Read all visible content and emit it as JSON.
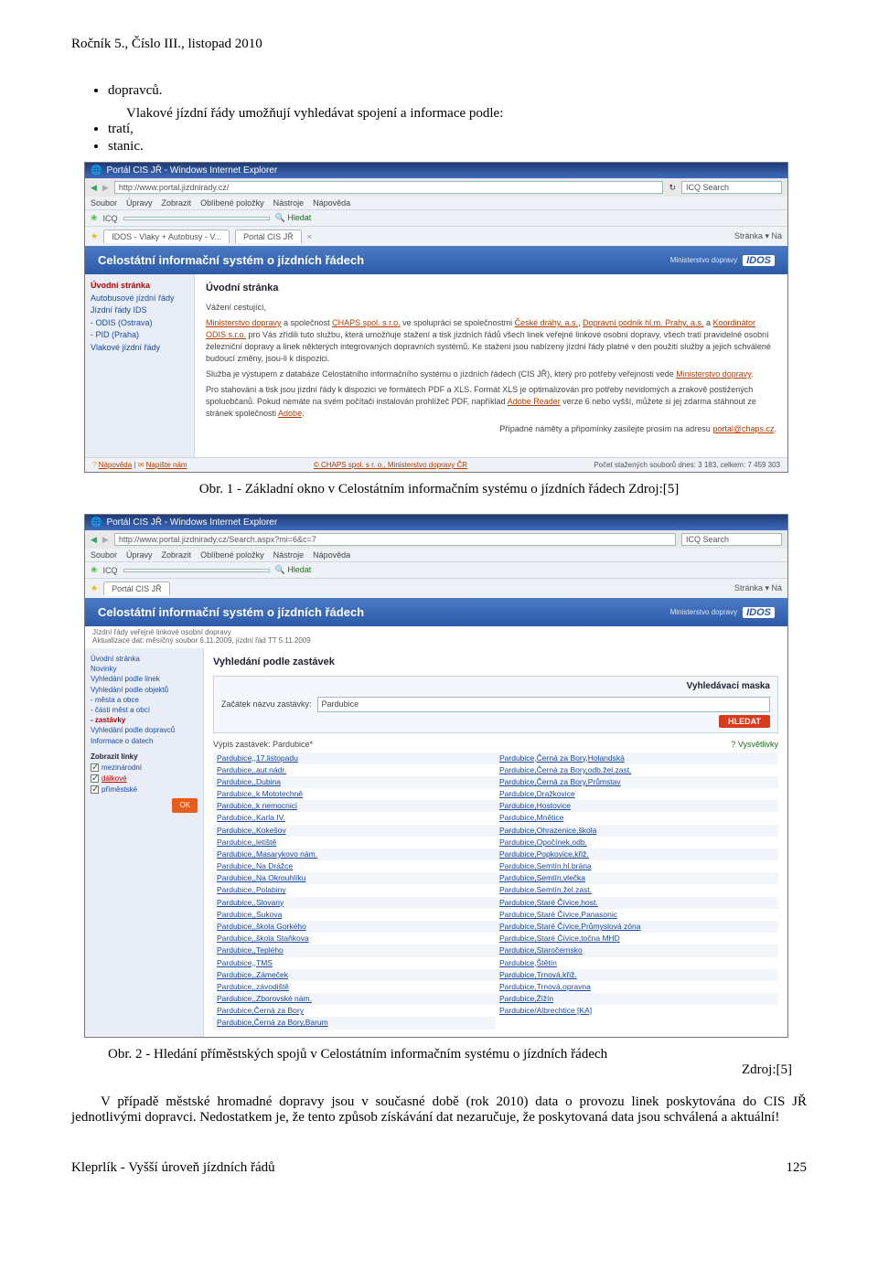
{
  "header": "Ročník 5., Číslo III., listopad 2010",
  "bullets": {
    "b1": "dopravců."
  },
  "lead": "Vlakové jízdní řády umožňují vyhledávat spojení a informace podle:",
  "bullets2": {
    "b1": "tratí,",
    "b2": "stanic."
  },
  "caption1": "Obr. 1 - Základní okno v Celostátním informačním systému o jízdních řádech    Zdroj:[5]",
  "caption2": "Obr. 2 - Hledání příměstských spojů v Celostátním informačním systému o jízdních řádech",
  "caption2b": "Zdroj:[5]",
  "para": "V případě městské hromadné dopravy jsou v současné době (rok 2010) data o provozu linek poskytována do CIS JŘ jednotlivými dopravci. Nedostatkem je, že tento způsob získávání dat nezaručuje, že poskytovaná data jsou schválená a aktuální!",
  "footer_left": "Kleprlík - Vyšší úroveň jízdních řádů",
  "footer_right": "125",
  "shot1": {
    "title": "Portál CIS JŘ - Windows Internet Explorer",
    "url": "http://www.portal.jizdnirady.cz/",
    "search": "ICQ Search",
    "menu": [
      "Soubor",
      "Úpravy",
      "Zobrazit",
      "Oblíbené položky",
      "Nástroje",
      "Nápověda"
    ],
    "icq": "ICQ",
    "hledat": "Hledat",
    "tab1": "IDOS - Vlaky + Autobusy - V...",
    "tab2": "Portál CIS JŘ",
    "toolbar_right": "Stránka ▾  Ná",
    "banner": "Celostátní informační systém o jízdních řádech",
    "mini": "Ministerstvo dopravy",
    "logo": "IDOS",
    "side": {
      "s1": "Úvodní stránka",
      "s2": "Autobusové jízdní řády",
      "s3": "Jízdní řády IDS",
      "s4": "- ODIS (Ostrava)",
      "s5": "- PID (Praha)",
      "s6": "Vlakové jízdní řády"
    },
    "main_h": "Úvodní stránka",
    "greet": "Vážení cestující,",
    "links": {
      "a": "Ministerstvo dopravy",
      "b": "CHAPS spol. s.r.o.",
      "c": "České dráhy, a.s.",
      "d": "Dopravní podnik hl.m. Prahy, a.s.",
      "e": "Koordinátor ODIS s.r.o."
    },
    "p1a": " a společnost ",
    "p1b": " ve spolupráci se společnostmi ",
    "p1c": ", ",
    "p1d": " a ",
    "p1e": " pro Vás zřídili tuto službu, která umožňuje stažení a tisk jízdních řádů všech linek veřejné linkové osobní dopravy, všech tratí pravidelné osobní železniční dopravy a linek některých integrovaných dopravních systémů. Ke stažení jsou nabízeny jízdní řády platné v den použití služby a jejich schválené budoucí změny, jsou-li k dispozici.",
    "p2a": "Služba je výstupem z databáze Celostátního informačního systému o jízdních řádech (CIS JŘ), který pro potřeby veřejnosti vede ",
    "p2l": "Ministerstvo dopravy",
    "p3a": "Pro stahování a tisk jsou jízdní řády k dispozici ve formátech PDF a XLS. Formát XLS je optimalizován pro potřeby nevidomých a zrakově postižených spoluobčanů. Pokud nemáte na svém počítači instalován prohlížeč PDF, například ",
    "p3l": "Adobe Reader",
    "p3b": " verze 6 nebo vyšší, můžete si jej zdarma stáhnout ze stránek společnosti ",
    "p3c": "Adobe",
    "p4a": "Případné náměty a připomínky zasílejte prosím na adresu ",
    "mail": "portal@chaps.cz",
    "foot_l1": "Nápověda",
    "foot_l2": "Napište nám",
    "foot_c": "© CHAPS spol. s r. o.,  Ministerstvo dopravy ČR",
    "foot_r": "Počet stažených souborů dnes: 3 183, celkem: 7 459 303"
  },
  "shot2": {
    "title": "Portál CIS JŘ - Windows Internet Explorer",
    "url": "http://www.portal.jizdnirady.cz/Search.aspx?mi=6&c=7",
    "tab": "Portál CIS JŘ",
    "banner": "Celostátní informační systém o jízdních řádech",
    "sub1": "Jízdní řády veřejné linkové osobní dopravy",
    "sub2": "Aktualizace dat: měsíčný soubor 6.11.2009, jízdní řád TT 5.11.2009",
    "side": {
      "s1": "Úvodní stránka",
      "s2": "Novinky",
      "s3": "Vyhledání podle linek",
      "s4": "Vyhledání podle objektů",
      "s5": "- města a obce",
      "s6": "- části měst a obcí",
      "s7": "- zastávky",
      "s8": "Vyhledání podle dopravců",
      "s9": "Informace o datech",
      "zl": "Zobrazit linky",
      "c1": "mezinárodní",
      "c2": "dálkové",
      "c3": "příměstské",
      "ok": "OK"
    },
    "main_h": "Vyhledání podle zastávek",
    "mask_title": "Vyhledávací maska",
    "mask_label": "Začátek názvu zastávky:",
    "mask_value": "Pardubice",
    "hledat": "HLEDAT",
    "res_l": "Výpis zastávek: Pardubice*",
    "res_r": "Vysvětlivky",
    "left_links": [
      "Pardubice,,17.listopadu",
      "Pardubice,,aut.nádr.",
      "Pardubice,,Dubina",
      "Pardubice,,k Mototechně",
      "Pardubice,,k nemocnici",
      "Pardubice,,Karla IV.",
      "Pardubice,,Kokešov",
      "Pardubice,,letiště",
      "Pardubice,,Masarykovo nám.",
      "Pardubice,,Na Drážce",
      "Pardubice,,Na Okrouhlíku",
      "Pardubice,,Polabiny",
      "Pardubice,,Slovany",
      "Pardubice,,Sukova",
      "Pardubice,,škola Gorkého",
      "Pardubice,,škola Staňkova",
      "Pardubice,,Teplého",
      "Pardubice,,TMS",
      "Pardubice,,Zámeček",
      "Pardubice,,závodiště",
      "Pardubice,,Zborovské nám.",
      "Pardubice,Černá za Bory",
      "Pardubice,Černá za Bory,Barum"
    ],
    "right_links": [
      "Pardubice,Černá za Bory,Holandská",
      "Pardubice,Černá za Bory,odb.žel.zast.",
      "Pardubice,Černá za Bory,Průmstav",
      "Pardubice,Dražkovice",
      "Pardubice,Hostovice",
      "Pardubice,Mnětice",
      "Pardubice,Ohrazenice,škola",
      "Pardubice,Opočínek,odb.",
      "Pardubice,Popkovice,křiž.",
      "Pardubice,Semtín,hl.brána",
      "Pardubice,Semtín,vlečka",
      "Pardubice,Semtín,žel.zast.",
      "Pardubice,Staré Čívice,host.",
      "Pardubice,Staré Čívice,Panasonic",
      "Pardubice,Staré Čívice,Průmyslová zóna",
      "Pardubice,Staré Čívice,točna MHD",
      "Pardubice,Staročernsko",
      "Pardubice,Štětín",
      "Pardubice,Trnová,křiž.",
      "Pardubice,Trnová,opravna",
      "Pardubice,Žižín",
      "Pardubice/Albrechtice [KA]"
    ]
  }
}
